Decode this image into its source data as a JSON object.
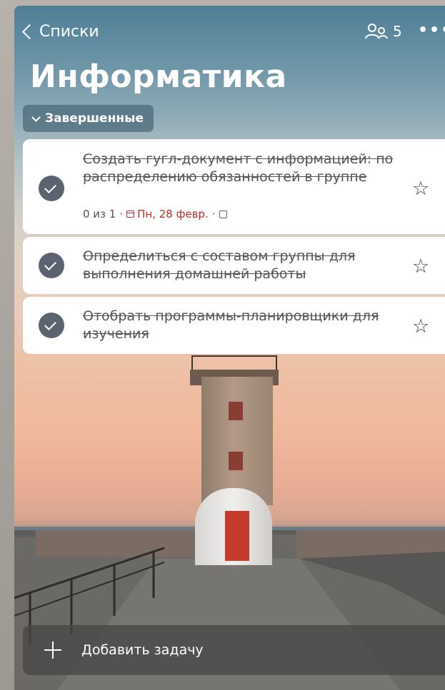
{
  "nav": {
    "back_label": "Списки",
    "shared_count": "5",
    "more_label": "•••"
  },
  "list": {
    "title": "Информатика"
  },
  "completed_section": {
    "label": "Завершенные"
  },
  "tasks": [
    {
      "text": "Создать гугл-документ с информацией: по распределению обязанностей в группе",
      "steps": "0 из 1",
      "separator": "·",
      "due": "Пн, 28 февр.",
      "completed": true,
      "starred": false
    },
    {
      "text": "Определиться с составом группы для выполнения домашней работы",
      "completed": true,
      "starred": false
    },
    {
      "text": "Отобрать программы-планировщики для изучения",
      "completed": true,
      "starred": false
    }
  ],
  "add_task": {
    "label": "Добавить задачу"
  },
  "icons": {
    "back": "chevron-left-icon",
    "share": "people-icon",
    "more": "more-icon",
    "check": "check-circle-icon",
    "star": "star-icon",
    "calendar": "calendar-icon",
    "note": "note-icon",
    "plus": "plus-icon"
  },
  "colors": {
    "accent_due": "#c12a2a",
    "check_fill": "#5b6370"
  }
}
